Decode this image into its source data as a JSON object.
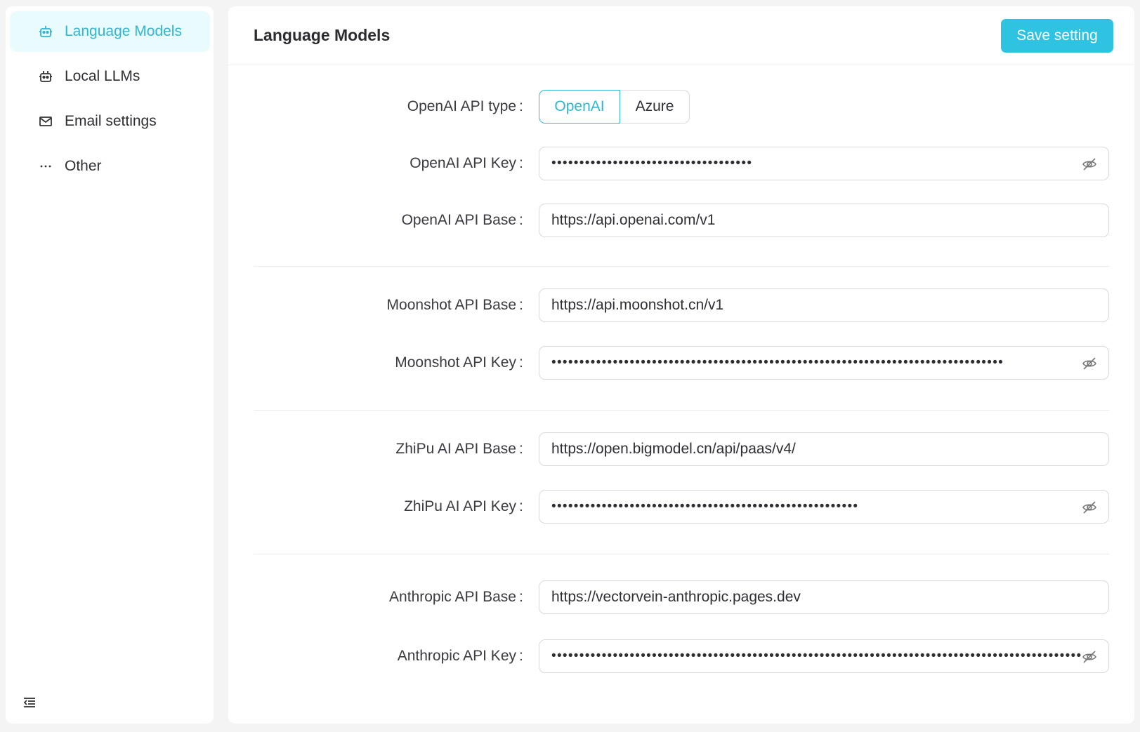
{
  "sidebar": {
    "items": [
      {
        "label": "Language Models",
        "icon": "robot-icon"
      },
      {
        "label": "Local LLMs",
        "icon": "robot-icon"
      },
      {
        "label": "Email settings",
        "icon": "mail-icon"
      },
      {
        "label": "Other",
        "icon": "ellipsis-icon"
      }
    ],
    "active_index": 0,
    "collapse_icon": "menu-collapse-icon"
  },
  "header": {
    "title": "Language Models",
    "save_label": "Save setting"
  },
  "form": {
    "openai_type": {
      "label": "OpenAI API type",
      "options": [
        "OpenAI",
        "Azure"
      ],
      "selected": "OpenAI"
    },
    "openai_key": {
      "label": "OpenAI API Key",
      "masked": "••••••••••••••••••••••••••••••••••••"
    },
    "openai_base": {
      "label": "OpenAI API Base",
      "value": "https://api.openai.com/v1"
    },
    "moonshot_base": {
      "label": "Moonshot API Base",
      "value": "https://api.moonshot.cn/v1"
    },
    "moonshot_key": {
      "label": "Moonshot API Key",
      "masked": "•••••••••••••••••••••••••••••••••••••••••••••••••••••••••••••••••••••••••••••••••"
    },
    "zhipu_base": {
      "label": "ZhiPu AI API Base",
      "value": "https://open.bigmodel.cn/api/paas/v4/"
    },
    "zhipu_key": {
      "label": "ZhiPu AI API Key",
      "masked": "•••••••••••••••••••••••••••••••••••••••••••••••••••••••"
    },
    "anthropic_base": {
      "label": "Anthropic API Base",
      "value": "https://vectorvein-anthropic.pages.dev"
    },
    "anthropic_key": {
      "label": "Anthropic API Key",
      "masked": "•••••••••••••••••••••••••••••••••••••••••••••••••••••••••••••••••••••••••••••••••••••••••••••••••••••••••••••••"
    }
  },
  "colors": {
    "accent": "#2ec3e0",
    "active_bg": "#e9fbfd",
    "active_text": "#2fb7d1"
  }
}
